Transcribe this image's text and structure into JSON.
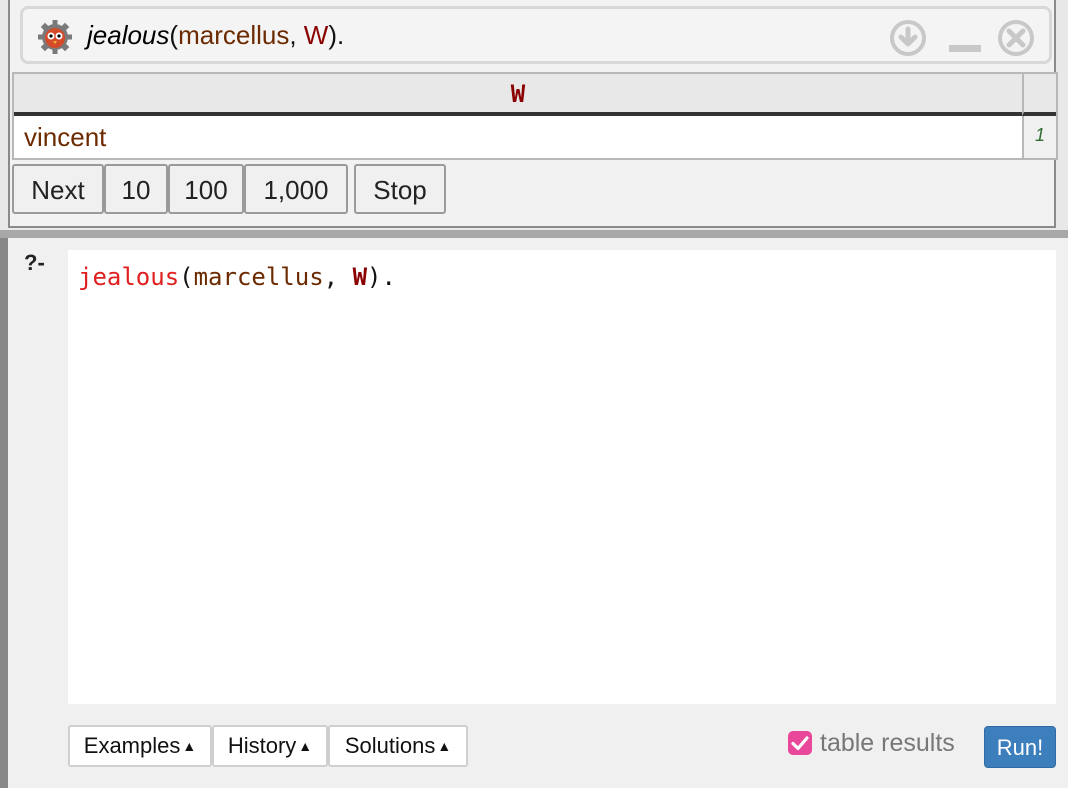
{
  "answer": {
    "query": {
      "predicate": "jealous",
      "open_paren": "(",
      "arg1": "marcellus",
      "separator": ", ",
      "arg2": "W",
      "end": ")."
    },
    "table": {
      "column_header": "W",
      "rows": [
        {
          "value": "vincent",
          "index": "1"
        }
      ]
    },
    "controls": {
      "next": "Next",
      "ten": "10",
      "hundred": "100",
      "thousand": "1,000",
      "stop": "Stop"
    },
    "header_icons": [
      "owl-logo-icon",
      "download-icon",
      "minimize-icon",
      "close-icon"
    ]
  },
  "editor": {
    "prompt": "?-",
    "code": {
      "predicate": "jealous",
      "open_paren": "(",
      "arg1": "marcellus",
      "separator": ", ",
      "arg2": "W",
      "end": ")."
    }
  },
  "bottom_bar": {
    "examples_label": "Examples",
    "history_label": "History",
    "solutions_label": "Solutions",
    "caret": "▲",
    "table_results_label": "table results",
    "table_results_checked": true,
    "run_label": "Run!"
  },
  "colors": {
    "predicate": "#e02020",
    "atom": "#6b2a00",
    "variable": "#8b0000",
    "row_index": "#2e6b2e",
    "checkbox": "#e8479a",
    "run_button": "#3d7ebd"
  }
}
